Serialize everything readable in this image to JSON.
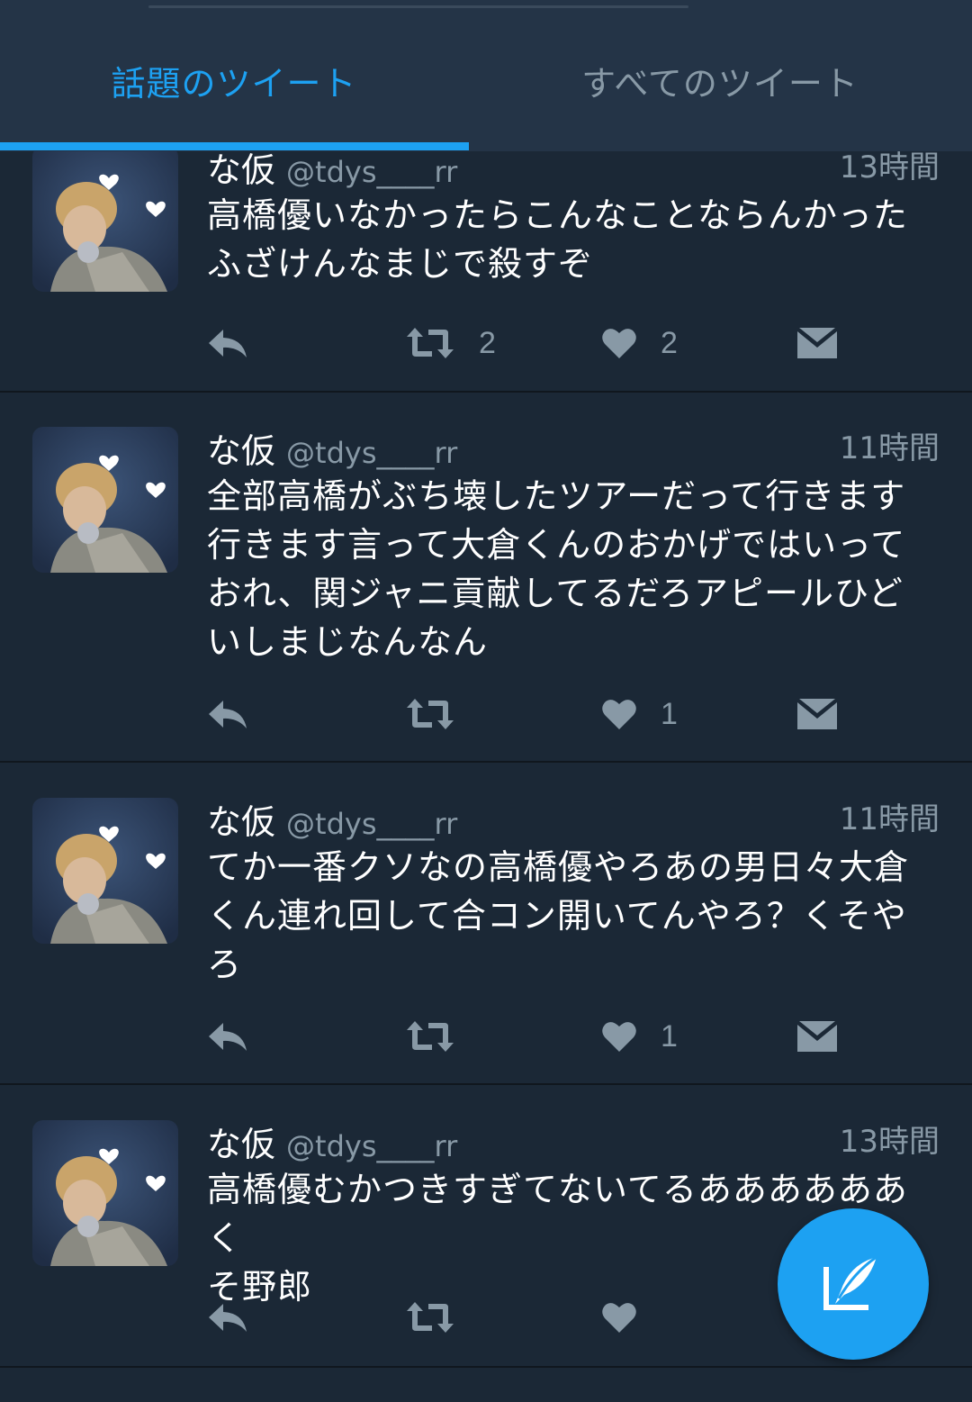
{
  "tabs": [
    {
      "label": "話題のツイート",
      "active": true
    },
    {
      "label": "すべてのツイート",
      "active": false
    }
  ],
  "tweets": [
    {
      "name": "な仮",
      "handle": "@tdys____rr",
      "time": "13時間",
      "text": "高橋優いなかったらこんなことならんかった\nふざけんなまじで殺すぞ",
      "retweets": "2",
      "likes": "2"
    },
    {
      "name": "な仮",
      "handle": "@tdys____rr",
      "time": "11時間",
      "text": "全部高橋がぶち壊したツアーだって行きます\n行きます言って大倉くんのおかげではいって\nおれ、関ジャニ貢献してるだろアピールひど\nいしまじなんなん",
      "retweets": "",
      "likes": "1"
    },
    {
      "name": "な仮",
      "handle": "@tdys____rr",
      "time": "11時間",
      "text": "てか一番クソなの高橋優やろあの男日々大倉\nくん連れ回して合コン開いてんやろ？くそや\nろ",
      "retweets": "",
      "likes": "1"
    },
    {
      "name": "な仮",
      "handle": "@tdys____rr",
      "time": "13時間",
      "text": "高橋優むかつきすぎてないてるああああああく\nそ野郎",
      "retweets": "",
      "likes": ""
    }
  ],
  "icons": {
    "reply": "reply-icon",
    "retweet": "retweet-icon",
    "like": "heart-icon",
    "dm": "envelope-icon",
    "compose": "compose-tweet-icon"
  },
  "colors": {
    "background": "#1b2836",
    "header": "#243447",
    "accent": "#1da1f2",
    "secondary_text": "#8899a6"
  }
}
